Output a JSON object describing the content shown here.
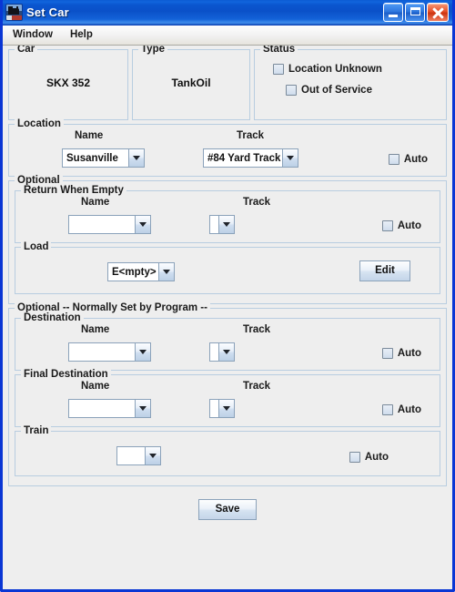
{
  "window": {
    "title": "Set Car",
    "icon": "locomotive-icon",
    "controls": {
      "minimize": "minimize-button",
      "maximize": "maximize-button",
      "close": "close-button"
    }
  },
  "menubar": {
    "items": [
      {
        "label": "Window"
      },
      {
        "label": "Help"
      }
    ]
  },
  "car_panel": {
    "title": "Car",
    "value": "SKX 352"
  },
  "type_panel": {
    "title": "Type",
    "value": "TankOil"
  },
  "status_panel": {
    "title": "Status",
    "checkboxes": [
      {
        "label": "Location Unknown",
        "checked": false
      },
      {
        "label": "Out of Service",
        "checked": false
      }
    ]
  },
  "location": {
    "title": "Location",
    "name_label": "Name",
    "track_label": "Track",
    "name_value": "Susanville",
    "track_value": "#84 Yard Track",
    "auto_label": "Auto",
    "auto_checked": false
  },
  "optional": {
    "title": "Optional",
    "return_when_empty": {
      "title": "Return When Empty",
      "name_label": "Name",
      "track_label": "Track",
      "name_value": "",
      "track_value": "",
      "auto_label": "Auto",
      "auto_checked": false
    },
    "load": {
      "title": "Load",
      "value": "E<mpty>",
      "edit_label": "Edit"
    }
  },
  "optional_program": {
    "title": "Optional -- Normally Set by Program --",
    "destination": {
      "title": "Destination",
      "name_label": "Name",
      "track_label": "Track",
      "name_value": "",
      "track_value": "",
      "auto_label": "Auto",
      "auto_checked": false
    },
    "final_destination": {
      "title": "Final Destination",
      "name_label": "Name",
      "track_label": "Track",
      "name_value": "",
      "track_value": "",
      "auto_label": "Auto",
      "auto_checked": false
    },
    "train": {
      "title": "Train",
      "value": "",
      "auto_label": "Auto",
      "auto_checked": false
    }
  },
  "footer": {
    "save_label": "Save"
  },
  "colors": {
    "titlebar_blue": "#0a57d0",
    "frame_border": "#0a36d4",
    "panel_background": "#eeeeee",
    "close_red": "#cc3410",
    "border_light_blue": "#b8cde0"
  }
}
